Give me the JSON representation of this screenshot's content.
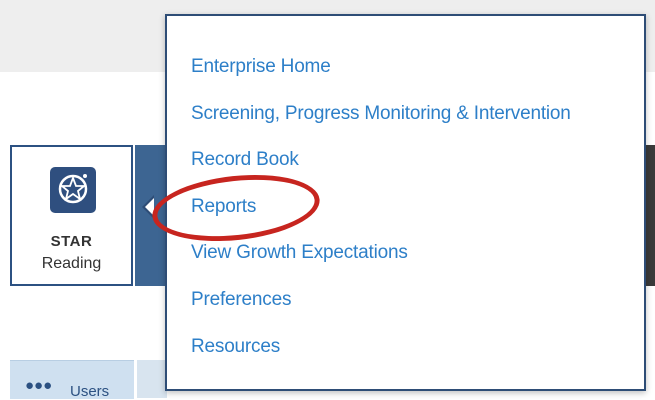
{
  "product_card": {
    "brand": "STAR",
    "name": "Reading"
  },
  "dropdown_menu": {
    "items": [
      {
        "label": "Enterprise Home"
      },
      {
        "label": "Screening, Progress Monitoring & Intervention"
      },
      {
        "label": "Record Book"
      },
      {
        "label": "Reports"
      },
      {
        "label": "View Growth Expectations"
      },
      {
        "label": "Preferences"
      },
      {
        "label": "Resources"
      }
    ],
    "highlighted_item": "Reports"
  },
  "bottom_tabs": {
    "users_label": "Users"
  },
  "colors": {
    "link": "#2d7fc8",
    "brand_navy": "#2e4d76",
    "highlight": "#c7251f"
  },
  "icons": {
    "product": "star-reading-logo-icon",
    "users": "users-icon"
  }
}
